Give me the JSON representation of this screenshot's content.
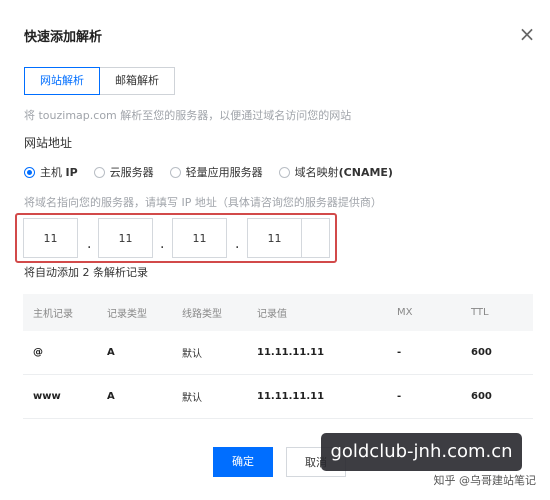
{
  "dialog": {
    "title": "快速添加解析",
    "close_icon": "close-icon"
  },
  "tabs": [
    {
      "label": "网站解析",
      "active": true
    },
    {
      "label": "邮箱解析",
      "active": false
    }
  ],
  "description": "将 touzimap.com 解析至您的服务器，以便通过域名访问您的网站",
  "site_address_label": "网站地址",
  "radio_options": [
    {
      "label_prefix": "主机 ",
      "label_bold": "IP",
      "selected": true
    },
    {
      "label_prefix": "云服务器",
      "label_bold": "",
      "selected": false
    },
    {
      "label_prefix": "轻量应用服务器",
      "label_bold": "",
      "selected": false
    },
    {
      "label_prefix": "域名映射",
      "label_bold": "(CNAME)",
      "selected": false
    }
  ],
  "ip_hint": "将域名指向您的服务器，请填写 IP 地址（具体请咨询您的服务器提供商）",
  "ip_octets": [
    "11",
    "11",
    "11",
    "11"
  ],
  "ip_separator": ".",
  "records_count_text": "将自动添加 2 条解析记录",
  "table": {
    "headers": [
      "主机记录",
      "记录类型",
      "线路类型",
      "记录值",
      "MX",
      "TTL"
    ],
    "rows": [
      [
        "@",
        "A",
        "默认",
        "11.11.11.11",
        "-",
        "600"
      ],
      [
        "www",
        "A",
        "默认",
        "11.11.11.11",
        "-",
        "600"
      ]
    ]
  },
  "buttons": {
    "confirm": "确定",
    "cancel": "取消"
  },
  "overlay": {
    "watermark_text": "goldclub-jnh.com.cn",
    "brand_text": "知乎 @乌哥建站笔记"
  },
  "colors": {
    "accent": "#006eff",
    "highlight_border": "#d24a4a"
  }
}
